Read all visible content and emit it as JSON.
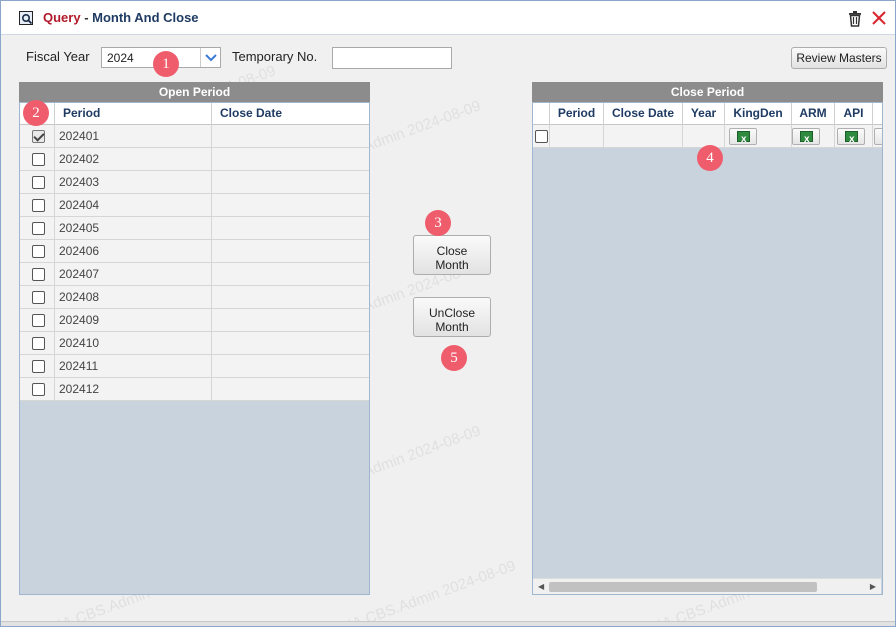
{
  "window": {
    "title_prefix": "Query",
    "title_separator": " - ",
    "title_main": "Month And Close"
  },
  "filters": {
    "fiscal_year_label": "Fiscal Year",
    "fiscal_year_value": "2024",
    "temporary_no_label": "Temporary No.",
    "temporary_no_value": ""
  },
  "buttons": {
    "review_masters": "Review Masters",
    "close_month_line1": "Close",
    "close_month_line2": "Month",
    "unclose_month_line1": "UnClose",
    "unclose_month_line2": "Month"
  },
  "open_period": {
    "title": "Open Period",
    "columns": [
      "Period",
      "Close Date"
    ],
    "rows": [
      {
        "period": "202401",
        "close_date": "",
        "checked": true
      },
      {
        "period": "202402",
        "close_date": "",
        "checked": false
      },
      {
        "period": "202403",
        "close_date": "",
        "checked": false
      },
      {
        "period": "202404",
        "close_date": "",
        "checked": false
      },
      {
        "period": "202405",
        "close_date": "",
        "checked": false
      },
      {
        "period": "202406",
        "close_date": "",
        "checked": false
      },
      {
        "period": "202407",
        "close_date": "",
        "checked": false
      },
      {
        "period": "202408",
        "close_date": "",
        "checked": false
      },
      {
        "period": "202409",
        "close_date": "",
        "checked": false
      },
      {
        "period": "202410",
        "close_date": "",
        "checked": false
      },
      {
        "period": "202411",
        "close_date": "",
        "checked": false
      },
      {
        "period": "202412",
        "close_date": "",
        "checked": false
      }
    ]
  },
  "close_period": {
    "title": "Close Period",
    "columns": [
      "Period",
      "Close Date",
      "Year",
      "KingDen",
      "ARM",
      "API"
    ]
  },
  "annotations": [
    "1",
    "2",
    "3",
    "4",
    "5"
  ],
  "watermark": "TLKA.CBS.Admin 2024-08-09",
  "colors": {
    "title_accent": "#b11a2a",
    "header_text": "#1f3b63",
    "panel_title_bg": "#8c8c8c",
    "grid_empty_bg": "#c9d3dd",
    "badge": "#ef5c6c",
    "excel_green": "#2e8a3e"
  }
}
